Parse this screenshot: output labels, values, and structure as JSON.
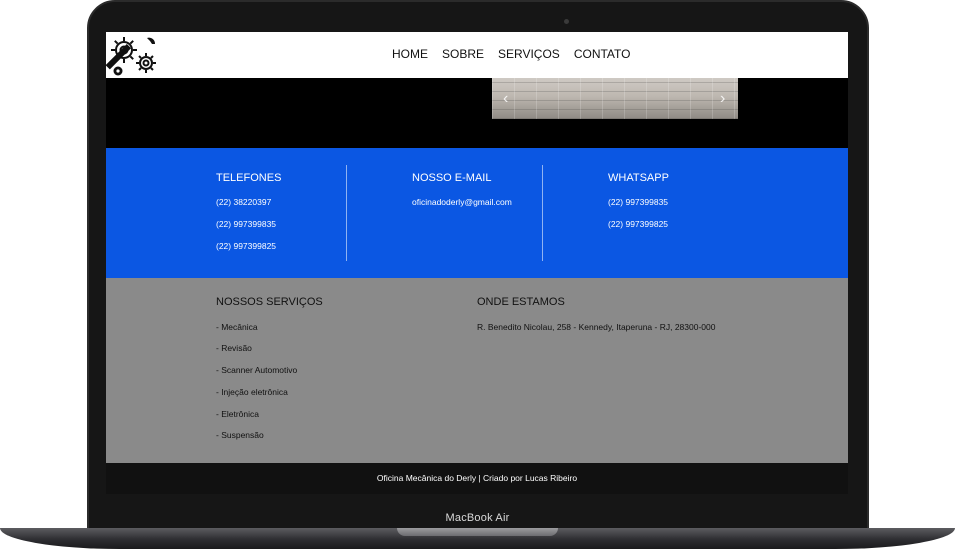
{
  "device": {
    "label": "MacBook Air"
  },
  "site": {
    "nav": [
      "HOME",
      "SOBRE",
      "SERVIÇOS",
      "CONTATO"
    ],
    "slider": {
      "prev": "‹",
      "next": "›"
    }
  },
  "contacts": {
    "phones": {
      "title": "TELEFONES",
      "items": [
        "(22) 38220397",
        "(22) 997399835",
        "(22) 997399825"
      ]
    },
    "email": {
      "title": "NOSSO E-MAIL",
      "items": [
        "oficinadoderly@gmail.com"
      ]
    },
    "whatsapp": {
      "title": "WHATSAPP",
      "items": [
        "(22) 997399835",
        "(22) 997399825"
      ]
    }
  },
  "services": {
    "title": "NOSSOS SERVIÇOS",
    "items": [
      "- Mecânica",
      "- Revisão",
      "- Scanner Automotivo",
      "- Injeção eletrônica",
      "- Eletrônica",
      "- Suspensão"
    ]
  },
  "location": {
    "title": "ONDE ESTAMOS",
    "address": "R. Benedito Nicolau, 258 - Kennedy, Itaperuna - RJ, 28300-000"
  },
  "footer": {
    "text": "Oficina Mecânica do Derly | Criado por Lucas Ribeiro"
  },
  "colors": {
    "blue_band": "#0b57e3",
    "gray_band": "#8a8a8a",
    "footer": "#111111"
  }
}
